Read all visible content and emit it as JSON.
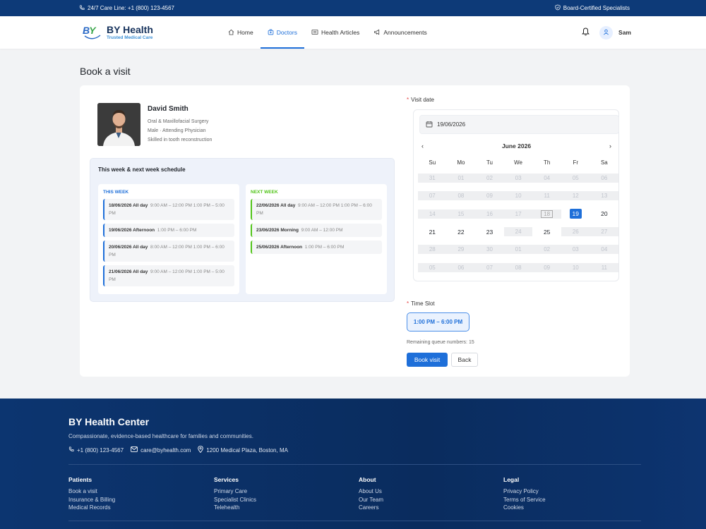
{
  "topbar": {
    "care_line": "24/7 Care Line: +1 (800) 123-4567",
    "badge": "Board-Certified Specialists"
  },
  "header": {
    "brand": "BY Health",
    "tagline": "Trusted Medical Care",
    "nav": [
      "Home",
      "Doctors",
      "Health Articles",
      "Announcements"
    ],
    "active_nav": "Doctors",
    "user": "Sam"
  },
  "page": {
    "title": "Book a visit"
  },
  "doctor": {
    "name": "David Smith",
    "specialty": "Oral & Maxillofacial Surgery",
    "role": "Male · Attending Physician",
    "skill": "Skilled in tooth reconstruction"
  },
  "schedule": {
    "title": "This week & next week schedule",
    "this_week": {
      "label": "THIS WEEK",
      "slots": [
        {
          "date": "18/06/2026 All day",
          "times": "9:00 AM – 12:00 PM 1:00 PM – 5:00 PM"
        },
        {
          "date": "19/06/2026 Afternoon",
          "times": "1:00 PM – 6:00 PM"
        },
        {
          "date": "20/06/2026 All day",
          "times": "8:00 AM – 12:00 PM 1:00 PM – 6:00 PM"
        },
        {
          "date": "21/06/2026 All day",
          "times": "9:00 AM – 12:00 PM 1:00 PM – 5:00 PM"
        }
      ]
    },
    "next_week": {
      "label": "NEXT WEEK",
      "slots": [
        {
          "date": "22/06/2026 All day",
          "times": "9:00 AM – 12:00 PM 1:00 PM – 6:00 PM"
        },
        {
          "date": "23/06/2026 Morning",
          "times": "9:00 AM – 12:00 PM"
        },
        {
          "date": "25/06/2026 Afternoon",
          "times": "1:00 PM – 6:00 PM"
        }
      ]
    }
  },
  "booking": {
    "visit_date_label": "Visit date",
    "date_value": "19/06/2026",
    "month": "June 2026",
    "prev": "‹",
    "next": "›",
    "weekdays": [
      "Su",
      "Mo",
      "Tu",
      "We",
      "Th",
      "Fr",
      "Sa"
    ],
    "days": [
      [
        "31",
        "01",
        "02",
        "03",
        "04",
        "05",
        "06"
      ],
      [
        "07",
        "08",
        "09",
        "10",
        "11",
        "12",
        "13"
      ],
      [
        "14",
        "15",
        "16",
        "17",
        "18",
        "19",
        "20"
      ],
      [
        "21",
        "22",
        "23",
        "24",
        "25",
        "26",
        "27"
      ],
      [
        "28",
        "29",
        "30",
        "01",
        "02",
        "03",
        "04"
      ],
      [
        "05",
        "06",
        "07",
        "08",
        "09",
        "10",
        "11"
      ]
    ],
    "active_days": [
      "19",
      "20",
      "21",
      "22",
      "23",
      "25"
    ],
    "today": "18",
    "selected": "19",
    "time_slot_label": "Time Slot",
    "time_slot": "1:00 PM – 6:00 PM",
    "queue": "Remaining queue numbers: 15",
    "book_btn": "Book visit",
    "back_btn": "Back"
  },
  "footer": {
    "title": "BY Health Center",
    "subtitle": "Compassionate, evidence-based healthcare for families and communities.",
    "phone": "+1 (800) 123-4567",
    "email": "care@byhealth.com",
    "address": "1200 Medical Plaza, Boston, MA",
    "columns": [
      {
        "title": "Patients",
        "links": [
          "Book a visit",
          "Insurance & Billing",
          "Medical Records"
        ]
      },
      {
        "title": "Services",
        "links": [
          "Primary Care",
          "Specialist Clinics",
          "Telehealth"
        ]
      },
      {
        "title": "About",
        "links": [
          "About Us",
          "Our Team",
          "Careers"
        ]
      },
      {
        "title": "Legal",
        "links": [
          "Privacy Policy",
          "Terms of Service",
          "Cookies"
        ]
      }
    ]
  },
  "colors": {
    "primary": "#1e6fd9",
    "navy": "#0d3a78",
    "green": "#52c41a"
  }
}
